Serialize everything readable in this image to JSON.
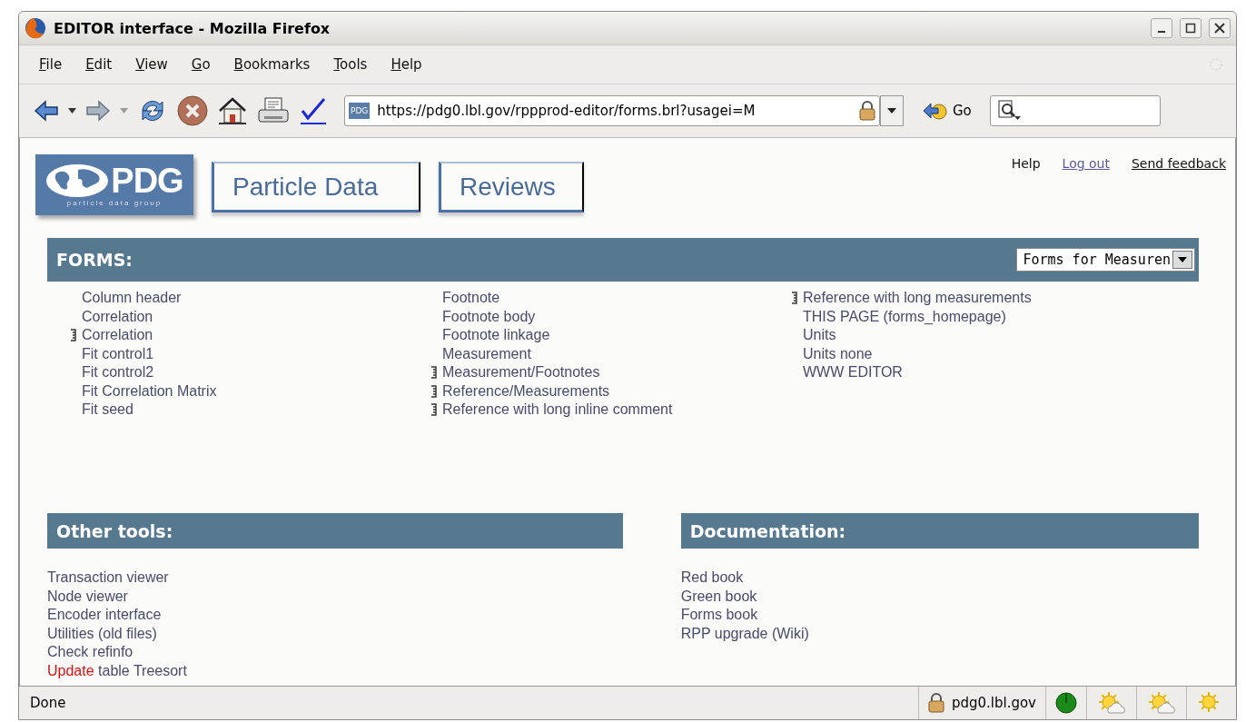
{
  "window": {
    "title": "EDITOR interface - Mozilla Firefox"
  },
  "menu": [
    "File",
    "Edit",
    "View",
    "Go",
    "Bookmarks",
    "Tools",
    "Help"
  ],
  "toolbar": {
    "url": "https://pdg0.lbl.gov/rppprod-editor/forms.brl?usagei=M",
    "favicon_text": "PDG",
    "go_label": "Go"
  },
  "header": {
    "logo": {
      "text": "PDG",
      "tagline": "particle data group"
    },
    "tabs": [
      "Particle Data",
      "Reviews"
    ],
    "links": [
      {
        "label": "Help",
        "kind": "plain"
      },
      {
        "label": "Log out",
        "kind": "visited"
      },
      {
        "label": "Send feedback",
        "kind": "link"
      }
    ]
  },
  "forms": {
    "title": "FORMS:",
    "dropdown": "Forms for Measuren",
    "columns": [
      [
        {
          "label": "Column header",
          "marked": false
        },
        {
          "label": "Correlation",
          "marked": false
        },
        {
          "label": "Correlation",
          "marked": true
        },
        {
          "label": "Fit control1",
          "marked": false
        },
        {
          "label": "Fit control2",
          "marked": false
        },
        {
          "label": "Fit Correlation Matrix",
          "marked": false
        },
        {
          "label": "Fit seed",
          "marked": false
        }
      ],
      [
        {
          "label": "Footnote",
          "marked": false
        },
        {
          "label": "Footnote body",
          "marked": false
        },
        {
          "label": "Footnote linkage",
          "marked": false
        },
        {
          "label": "Measurement",
          "marked": false
        },
        {
          "label": "Measurement/Footnotes",
          "marked": true
        },
        {
          "label": "Reference/Measurements",
          "marked": true
        },
        {
          "label": "Reference with long inline comment",
          "marked": true
        }
      ],
      [
        {
          "label": "Reference with long measurements",
          "marked": true
        },
        {
          "label": "THIS PAGE (forms_homepage)",
          "marked": false
        },
        {
          "label": "Units",
          "marked": false
        },
        {
          "label": "Units none",
          "marked": false
        },
        {
          "label": "WWW EDITOR",
          "marked": false
        }
      ]
    ]
  },
  "other_tools": {
    "title": "Other tools:",
    "items": [
      {
        "label": "Transaction viewer"
      },
      {
        "label": "Node viewer"
      },
      {
        "label": "Encoder interface"
      },
      {
        "label": "Utilities (old files)"
      },
      {
        "label": "Check refinfo"
      },
      {
        "label": "table Treesort",
        "prefix": "Update"
      }
    ]
  },
  "documentation": {
    "title": "Documentation:",
    "items": [
      {
        "label": "Red book"
      },
      {
        "label": "Green book"
      },
      {
        "label": "Forms book"
      },
      {
        "label": "RPP upgrade (Wiki)"
      }
    ]
  },
  "status_bar": {
    "text": "Done",
    "host": "pdg0.lbl.gov"
  }
}
